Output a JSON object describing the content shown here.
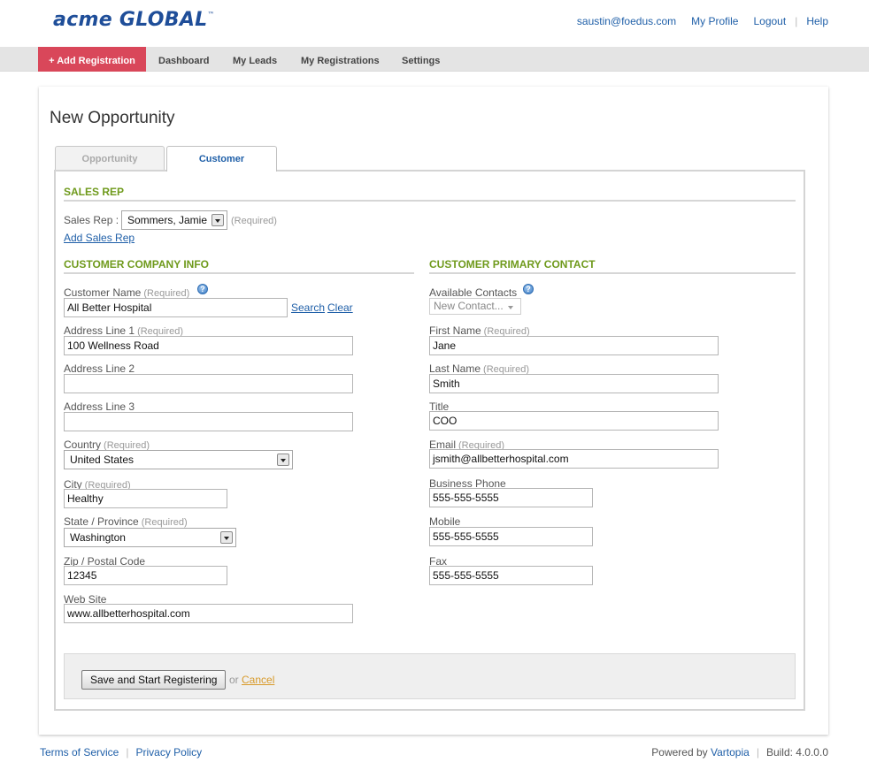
{
  "header": {
    "logo_text": "acme GLOBAL",
    "logo_tm": "™",
    "user_email": "saustin@foedus.com",
    "my_profile": "My Profile",
    "logout": "Logout",
    "help": "Help"
  },
  "nav": {
    "add_registration": "+ Add Registration",
    "items": [
      "Dashboard",
      "My Leads",
      "My Registrations",
      "Settings"
    ]
  },
  "page": {
    "title": "New Opportunity",
    "tabs": [
      "Opportunity",
      "Customer"
    ],
    "active_tab": "Customer"
  },
  "sales_rep": {
    "section": "SALES REP",
    "label": "Sales Rep :",
    "value": "Sommers, Jamie",
    "required": "(Required)",
    "add_link": "Add Sales Rep"
  },
  "company": {
    "section": "CUSTOMER COMPANY INFO",
    "customer_name": {
      "label": "Customer Name",
      "required": "(Required)",
      "value": "All Better Hospital"
    },
    "search_link": "Search",
    "clear_link": "Clear",
    "address1": {
      "label": "Address Line 1",
      "required": "(Required)",
      "value": "100 Wellness Road"
    },
    "address2": {
      "label": "Address Line 2",
      "value": ""
    },
    "address3": {
      "label": "Address Line 3",
      "value": ""
    },
    "country": {
      "label": "Country",
      "required": "(Required)",
      "value": "United States"
    },
    "city": {
      "label": "City",
      "required": "(Required)",
      "value": "Healthy"
    },
    "state": {
      "label": "State / Province",
      "required": "(Required)",
      "value": "Washington"
    },
    "zip": {
      "label": "Zip / Postal Code",
      "value": "12345"
    },
    "website": {
      "label": "Web Site",
      "value": "www.allbetterhospital.com"
    }
  },
  "contact": {
    "section": "CUSTOMER PRIMARY CONTACT",
    "available": {
      "label": "Available Contacts",
      "value": "New Contact..."
    },
    "first_name": {
      "label": "First Name",
      "required": "(Required)",
      "value": "Jane"
    },
    "last_name": {
      "label": "Last Name",
      "required": "(Required)",
      "value": "Smith"
    },
    "title": {
      "label": "Title",
      "value": "COO"
    },
    "email": {
      "label": "Email",
      "required": "(Required)",
      "value": "jsmith@allbetterhospital.com"
    },
    "business_phone": {
      "label": "Business Phone",
      "value": "555-555-5555"
    },
    "mobile": {
      "label": "Mobile",
      "value": "555-555-5555"
    },
    "fax": {
      "label": "Fax",
      "value": "555-555-5555"
    }
  },
  "actions": {
    "save": "Save and Start Registering",
    "or": "or",
    "cancel": "Cancel"
  },
  "footer": {
    "terms": "Terms of Service",
    "privacy": "Privacy Policy",
    "powered_by": "Powered by",
    "vendor": "Vartopia",
    "build": "Build: 4.0.0.0"
  },
  "colors": {
    "brand_blue": "#1f4e99",
    "add_button_red": "#d9475a",
    "section_green": "#6f9a1c",
    "cancel_orange": "#d89a2a"
  },
  "icons": [
    "help-icon",
    "dropdown-arrow-icon"
  ]
}
